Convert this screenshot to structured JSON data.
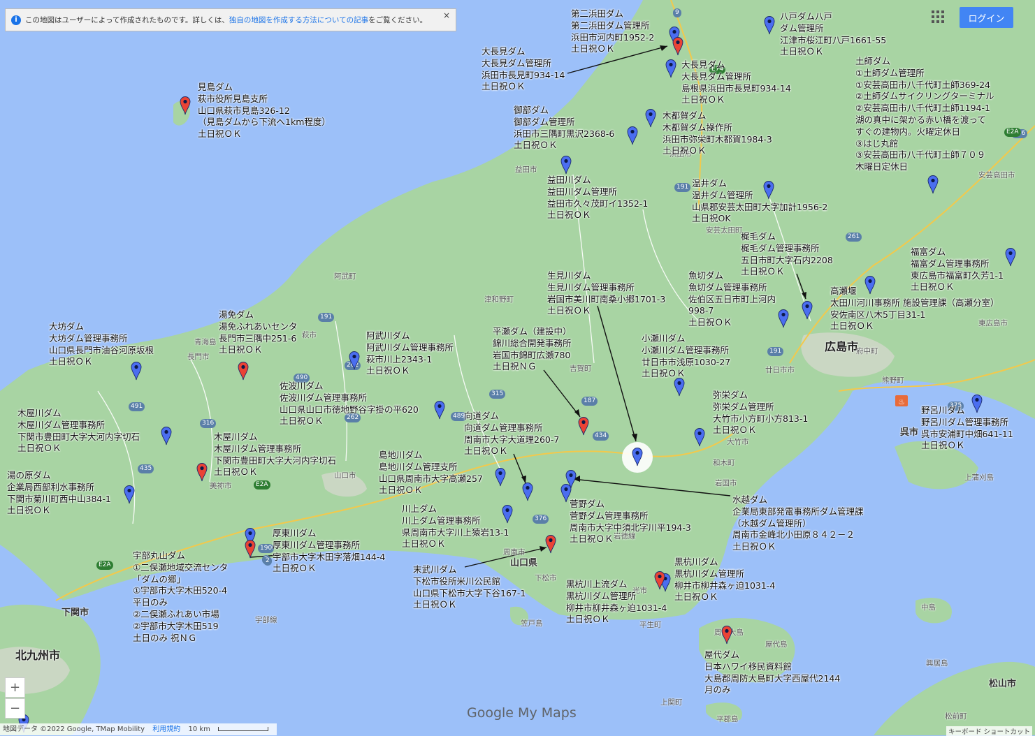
{
  "notice": {
    "text1": "この地図はユーザーによって作成されたものです。詳しくは、",
    "link": "独自の地図を作成する方法についての記事",
    "text2": "をご覧ください。",
    "close": "×"
  },
  "login_label": "ログイン",
  "zoom": {
    "in": "+",
    "out": "−"
  },
  "footer": {
    "data": "地図データ ©2022 Google, TMap Mobility",
    "terms": "利用規約",
    "scale": "10 km"
  },
  "shortcut": "キーボード ショートカット",
  "logo": {
    "google": "Google",
    "mymaps": " My Maps"
  },
  "colors": {
    "sea": "#9cc0f9",
    "land": "#a8d4a3",
    "pin_blue": "#4b6ef0",
    "pin_red": "#ea4335"
  },
  "places": [
    {
      "name": "北九州市",
      "cls": "big"
    },
    {
      "name": "下関市",
      "cls": "mid"
    },
    {
      "name": "広島市",
      "cls": "big"
    },
    {
      "name": "呉市",
      "cls": "mid"
    },
    {
      "name": "山口県",
      "cls": "mid"
    },
    {
      "name": "長門市",
      "cls": ""
    },
    {
      "name": "萩市",
      "cls": ""
    },
    {
      "name": "益田市",
      "cls": ""
    },
    {
      "name": "浜田市",
      "cls": ""
    },
    {
      "name": "津和野町",
      "cls": ""
    },
    {
      "name": "阿武町",
      "cls": ""
    },
    {
      "name": "吉賀町",
      "cls": ""
    },
    {
      "name": "美祢市",
      "cls": ""
    },
    {
      "name": "山口市",
      "cls": ""
    },
    {
      "name": "周南市",
      "cls": ""
    },
    {
      "name": "下松市",
      "cls": ""
    },
    {
      "name": "光市",
      "cls": ""
    },
    {
      "name": "岩国市",
      "cls": ""
    },
    {
      "name": "大竹市",
      "cls": ""
    },
    {
      "name": "廿日市市",
      "cls": ""
    },
    {
      "name": "安芸高田市",
      "cls": ""
    },
    {
      "name": "東広島市",
      "cls": ""
    },
    {
      "name": "府中町",
      "cls": ""
    },
    {
      "name": "熊野町",
      "cls": ""
    },
    {
      "name": "松山市",
      "cls": "mid"
    },
    {
      "name": "屋代島",
      "cls": ""
    },
    {
      "name": "上関町",
      "cls": ""
    },
    {
      "name": "平郡島",
      "cls": ""
    },
    {
      "name": "笠戸島",
      "cls": ""
    },
    {
      "name": "岩徳線",
      "cls": ""
    },
    {
      "name": "和木町",
      "cls": ""
    },
    {
      "name": "青海島",
      "cls": ""
    },
    {
      "name": "周防大島",
      "cls": ""
    },
    {
      "name": "中島",
      "cls": ""
    },
    {
      "name": "上蒲刈島",
      "cls": ""
    },
    {
      "name": "興居島",
      "cls": ""
    },
    {
      "name": "松前町",
      "cls": ""
    },
    {
      "name": "平生町",
      "cls": ""
    },
    {
      "name": "宇部線",
      "cls": ""
    },
    {
      "name": "安芸太田町",
      "cls": ""
    }
  ],
  "labels": [
    {
      "text": "見島ダム\n萩市役所見島支所\n山口県萩市見島326-12\n（見島ダムから下流へ1km程度）\n土日祝ＯＫ"
    },
    {
      "text": "第二浜田ダム\n第二浜田ダム管理所\n浜田市河内町1952-2\n土日祝ＯＫ"
    },
    {
      "text": "八戸ダム八戸\nダム管理所\n江津市桜江町八戸1661-55\n土日祝ＯＫ"
    },
    {
      "text": "大長見ダム\n大長見ダム管理所\n浜田市長見町934-14\n土日祝ＯＫ"
    },
    {
      "text": "大長見ダム\n大長見ダム管理所\n島根県浜田市長見町934-14\n土日祝ＯＫ"
    },
    {
      "text": "土師ダム\n①土師ダム管理所\n①安芸高田市八千代町土師369-24\n②土師ダムサイクリングターミナル\n②安芸高田市八千代町土師1194-1\n湖の真中に架かる赤い橋を渡って\nすぐの建物内。火曜定休日\n③はじ丸館\n③安芸高田市八千代町土師７０９\n木曜日定休日"
    },
    {
      "text": "御部ダム\n御部ダム管理所\n浜田市三隅町黒沢2368-6\n土日祝ＯＫ"
    },
    {
      "text": "木都賀ダム\n木都賀ダム操作所\n浜田市弥栄町木都賀1984-3\n土日祝ＯＫ"
    },
    {
      "text": "益田川ダム\n益田川ダム管理所\n益田市久々茂町イ1352-1\n土日祝ＯＫ"
    },
    {
      "text": "温井ダム\n温井ダム管理所\n山県郡安芸太田町大字加計1956-2\n土日祝OK"
    },
    {
      "text": "梶毛ダム\n梶毛ダム管理事務所\n五日市町大字石内2208\n土日祝ＯＫ"
    },
    {
      "text": "福富ダム\n福富ダム管理事務所\n東広島市福富町久芳1-1\n土日祝ＯＫ"
    },
    {
      "text": "生見川ダム\n生見川ダム管理事務所\n岩国市美川町南桑小郷1701-3\n土日祝ＯＫ"
    },
    {
      "text": "魚切ダム\n魚切ダム管理事務所\n佐伯区五日市町上河内\n998-7\n土日祝ＯＫ"
    },
    {
      "text": "高瀬堰\n太田川河川事務所 施設管理課（高瀬分室）\n安佐南区八木5丁目31-1\n土日祝ＯＫ"
    },
    {
      "text": "湯免ダム\n湯免ふれあいセンタ\n長門市三隅中251-6\n土日祝ＯＫ"
    },
    {
      "text": "大坊ダム\n大坊ダム管理事務所\n山口県長門市油谷河原坂根\n土日祝ＯＫ"
    },
    {
      "text": "阿武川ダム\n阿武川ダム管理事務所\n萩市川上2343-1\n土日祝ＯＫ"
    },
    {
      "text": "平瀬ダム（建設中）\n錦川総合開発事務所\n岩国市錦町広瀬780\n土日祝ＮＧ"
    },
    {
      "text": "小瀬川ダム\n小瀬川ダム管理事務所\n廿日市市浅原1030-27\n土日祝ＯＫ"
    },
    {
      "text": "佐波川ダム\n佐波川ダム管理事務所\n山口県山口市徳地野谷字掛の平620\n土日祝ＯＫ"
    },
    {
      "text": "木屋川ダム\n木屋川ダム管理事務所\n下関市豊田町大字大河内字切石\n土日祝ＯＫ"
    },
    {
      "text": "向道ダム\n向道ダム管理事務所\n周南市大字大道理260-7\n土日祝ＯＫ"
    },
    {
      "text": "弥栄ダム\n弥栄ダム管理所\n大竹市小方町小方813-1\n土日祝ＯＫ"
    },
    {
      "text": "野呂川ダム\n野呂川ダム管理事務所\n呉市安浦町中畑641-11\n土日祝ＯＫ"
    },
    {
      "text": "木屋川ダム\n木屋川ダム管理事務所\n下関市豊田町大字大河内字切石\n土日祝ＯＫ"
    },
    {
      "text": "島地川ダム\n島地川ダム管理支所\n山口県周南市大字高瀬257\n土日祝ＯＫ"
    },
    {
      "text": "湯の原ダム\n企業局西部利水事務所\n下関市菊川町西中山384-1\n土日祝ＯＫ"
    },
    {
      "text": "水越ダム\n企業局東部発電事務所ダム管理課\n（水越ダム管理所）\n周南市金峰北小田原８４２－２\n土日祝ＯＫ"
    },
    {
      "text": "菅野ダム\n菅野ダム管理事務所\n周南市大字中須北字川平194-3\n土日祝ＯＫ"
    },
    {
      "text": "川上ダム\n川上ダム管理事務所\n県周南市大字川上猿岩13-1\n土日祝ＯＫ"
    },
    {
      "text": "厚東川ダム\n厚東川ダム管理事務所\n宇部市大字木田字落畑144-4\n土日祝ＯＫ"
    },
    {
      "text": "宇部丸山ダム\n①二俣瀬地域交流センタ\n「ダムの郷」\n①宇部市大字木田520-4\n平日のみ\n②二俣瀬ふれあい市場\n②宇部市大字木田519\n土日のみ 祝ＮＧ"
    },
    {
      "text": "末武川ダム\n下松市役所米川公民館\n山口県下松市大字下谷167-1\n土日祝ＯＫ"
    },
    {
      "text": "黒杭川ダム\n黒杭川ダム管理所\n柳井市柳井森ヶ迫1031-4\n土日祝ＯＫ"
    },
    {
      "text": "黒杭川上流ダム\n黒杭川ダム管理所\n柳井市柳井森ヶ迫1031-4\n土日祝ＯＫ"
    },
    {
      "text": "屋代ダム\n日本ハワイ移民資料館\n大島郡周防大島町大字西屋代2144\n月のみ"
    }
  ],
  "routes": [
    "9",
    "E74",
    "191",
    "261",
    "186",
    "191",
    "375",
    "2",
    "191",
    "262",
    "490",
    "262",
    "316",
    "435",
    "491",
    "E2A",
    "489",
    "187",
    "434",
    "315",
    "376",
    "190",
    "2",
    "E2A",
    "E2A"
  ]
}
